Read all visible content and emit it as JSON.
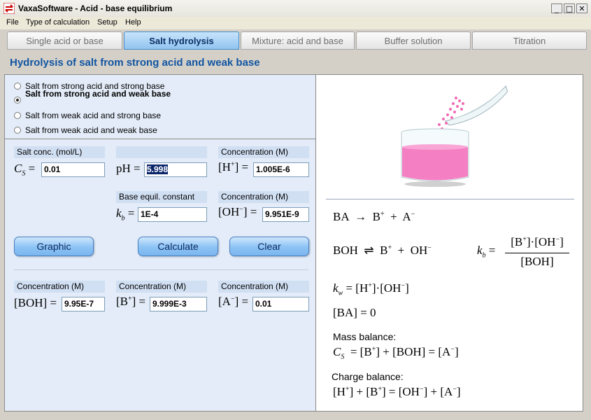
{
  "window": {
    "title": "VaxaSoftware - Acid - base equilibrium"
  },
  "menu": [
    "File",
    "Type of calculation",
    "Setup",
    "Help"
  ],
  "tabs": [
    {
      "label": "Single acid or base",
      "active": false
    },
    {
      "label": "Salt hydrolysis",
      "active": true
    },
    {
      "label": "Mixture: acid and base",
      "active": false
    },
    {
      "label": "Buffer solution",
      "active": false
    },
    {
      "label": "Titration",
      "active": false
    }
  ],
  "heading": "Hydrolysis of salt from strong acid and weak base",
  "radios": [
    {
      "label": "Salt from strong acid and strong base",
      "checked": false
    },
    {
      "label": "Salt from strong acid and weak base",
      "checked": true
    },
    {
      "label": "Salt from weak acid and strong base",
      "checked": false
    },
    {
      "label": "Salt from weak acid and weak base",
      "checked": false
    }
  ],
  "inputs": {
    "salt_conc_label": "Salt conc. (mol/L)",
    "cs_value": "0.01",
    "ph_value": "5.998",
    "conc_label": "Concentration (M)",
    "h_value": "1.005E-6",
    "base_const_label": "Base equil. constant",
    "kb_value": "1E-4",
    "oh_value": "9.951E-9",
    "boh_value": "9.95E-7",
    "b_value": "9.999E-3",
    "a_value": "0.01"
  },
  "buttons": {
    "graphic": "Graphic",
    "calculate": "Calculate",
    "clear": "Clear"
  },
  "equations": {
    "mass_balance_label": "Mass balance:",
    "charge_balance_label": "Charge balance:"
  },
  "colors": {
    "accent": "#1255a2",
    "panel_bg": "#e3ecf8",
    "label_bg": "#d1dff3",
    "liquid": "#f47fc2"
  },
  "icons": [
    "acid-base-app-icon",
    "minimize-icon",
    "maximize-icon",
    "close-icon",
    "beaker-illustration"
  ]
}
